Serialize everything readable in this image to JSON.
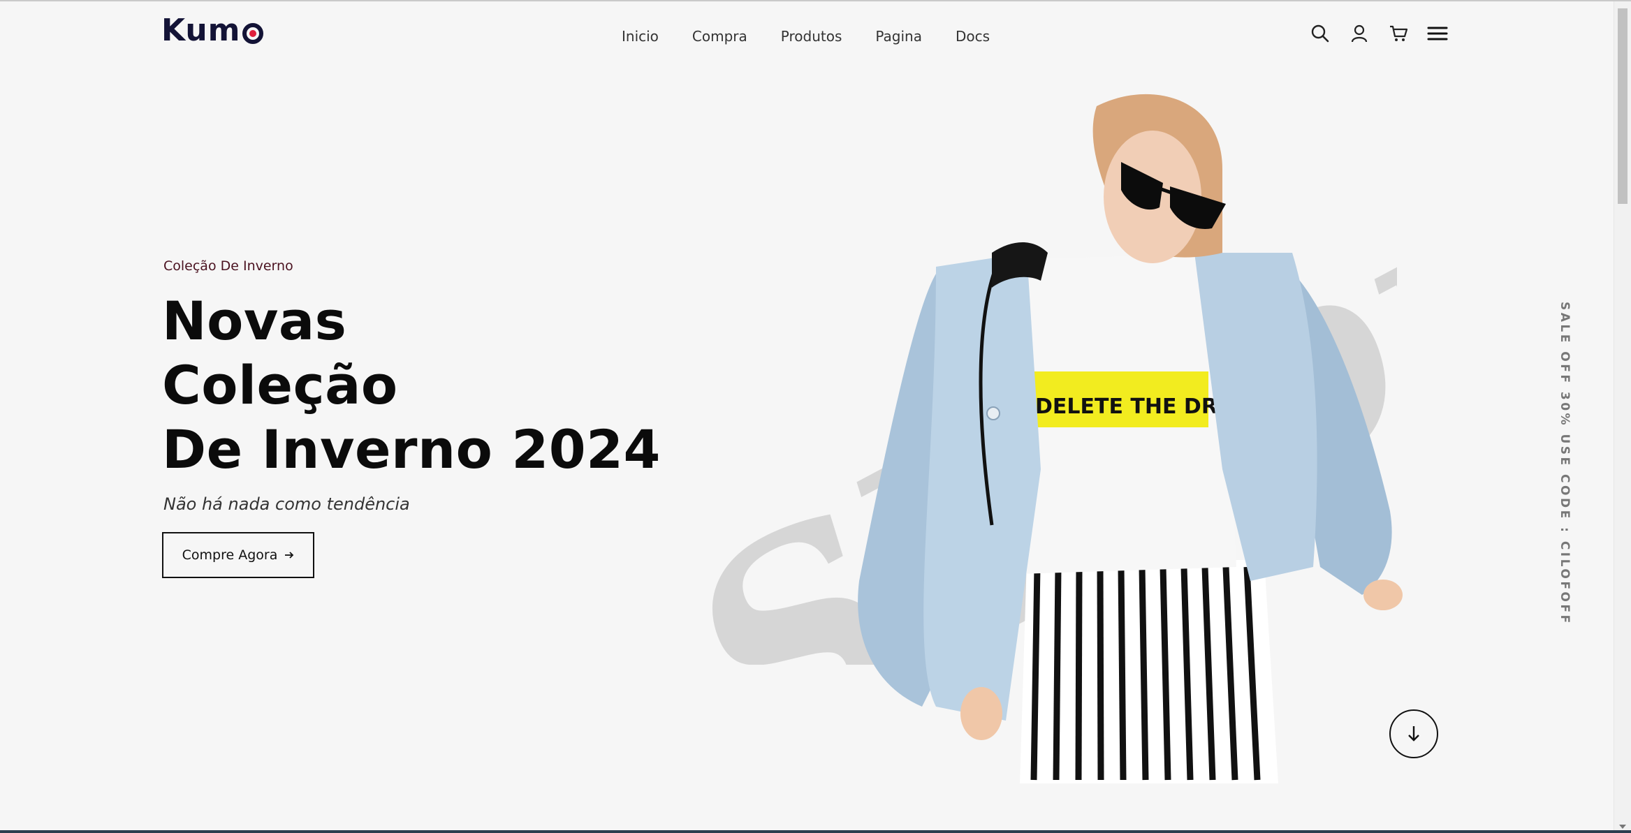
{
  "brand": {
    "logo_text": "Kum",
    "logo_accent": "#e0203c",
    "logo_color": "#131336"
  },
  "nav": {
    "items": [
      {
        "label": "Inicio"
      },
      {
        "label": "Compra"
      },
      {
        "label": "Produtos"
      },
      {
        "label": "Pagina"
      },
      {
        "label": "Docs"
      }
    ]
  },
  "header_icons": [
    "search-icon",
    "user-icon",
    "cart-icon",
    "menu-icon"
  ],
  "hero": {
    "eyebrow": "Coleção De Inverno",
    "title_lines": [
      "Novas",
      "Coleção",
      "De Inverno 2024"
    ],
    "subtitle": "Não há nada como tendência",
    "cta_label": "Compre Agora",
    "cta_icon": "arrow-right-icon",
    "watermark_text": "Shopping",
    "model_shirt_text": "DELETE THE DRAMA"
  },
  "side_promo": "SALE OFF 30% USE CODE : CILOFOFF",
  "scroll_button_icon": "arrow-down-icon"
}
